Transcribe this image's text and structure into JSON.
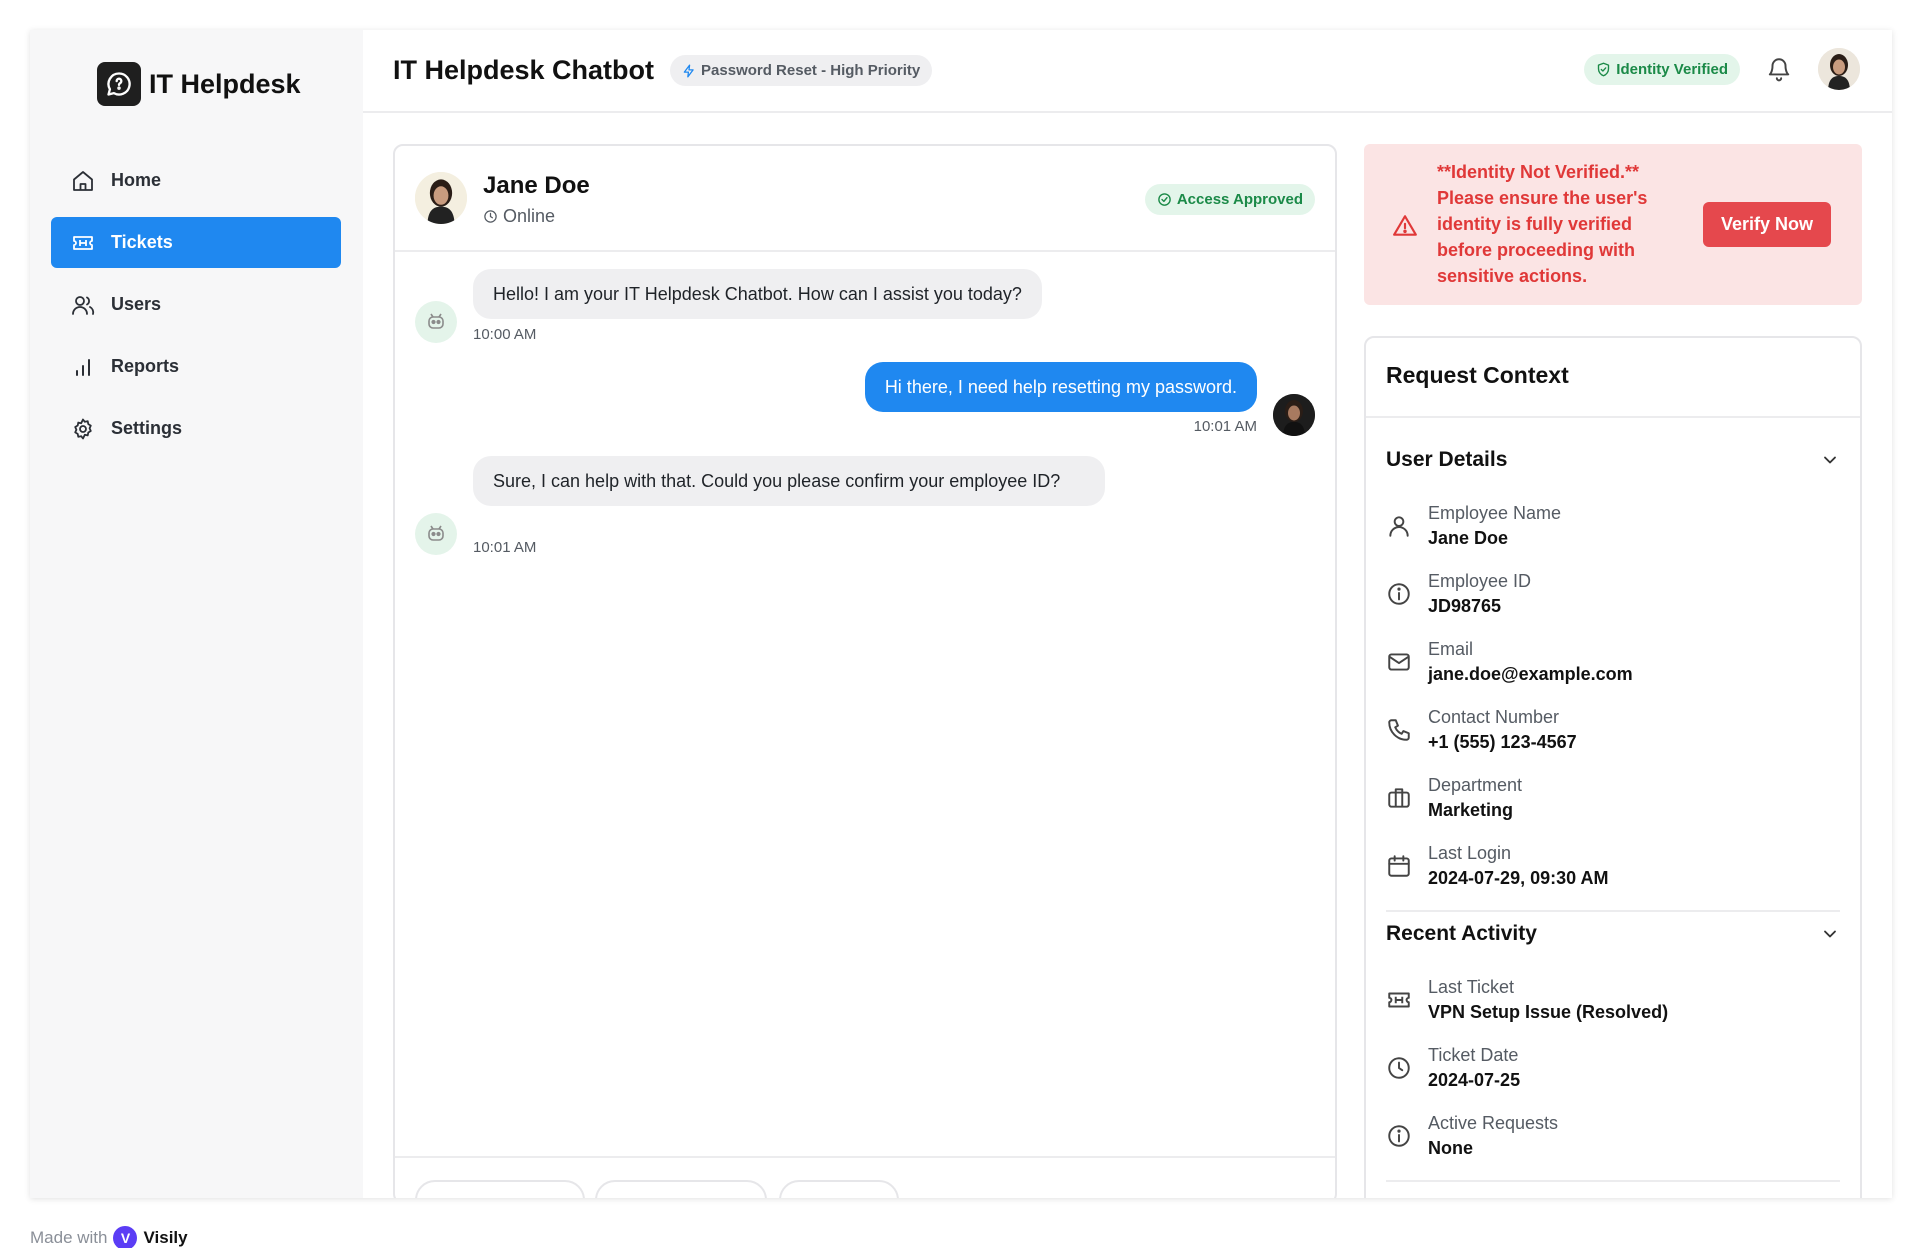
{
  "brand": {
    "name": "IT Helpdesk"
  },
  "sidebar": {
    "items": [
      {
        "label": "Home",
        "icon": "home-icon",
        "active": false
      },
      {
        "label": "Tickets",
        "icon": "ticket-icon",
        "active": true
      },
      {
        "label": "Users",
        "icon": "users-icon",
        "active": false
      },
      {
        "label": "Reports",
        "icon": "bar-chart-icon",
        "active": false
      },
      {
        "label": "Settings",
        "icon": "gear-icon",
        "active": false
      }
    ]
  },
  "header": {
    "title": "IT Helpdesk Chatbot",
    "topic_badge": "Password Reset - High Priority",
    "verified_badge": "Identity Verified"
  },
  "chat": {
    "user_name": "Jane Doe",
    "status": "Online",
    "access_badge": "Access Approved",
    "messages": [
      {
        "from": "bot",
        "text": "Hello! I am your IT Helpdesk Chatbot. How can I assist you today?",
        "time": "10:00 AM"
      },
      {
        "from": "user",
        "text": "Hi there, I need help resetting my password.",
        "time": "10:01 AM"
      },
      {
        "from": "bot",
        "text": "Sure, I can help with that. Could you please confirm your employee ID?",
        "time": "10:01 AM"
      }
    ]
  },
  "alert": {
    "text": "**Identity Not Verified.** Please ensure the user's identity is fully verified before proceeding with sensitive actions.",
    "button": "Verify Now"
  },
  "context": {
    "title": "Request Context",
    "user_details": {
      "heading": "User Details",
      "items": [
        {
          "label": "Employee Name",
          "value": "Jane Doe",
          "icon": "user-icon"
        },
        {
          "label": "Employee ID",
          "value": "JD98765",
          "icon": "info-icon"
        },
        {
          "label": "Email",
          "value": "jane.doe@example.com",
          "icon": "mail-icon"
        },
        {
          "label": "Contact Number",
          "value": "+1 (555) 123-4567",
          "icon": "phone-icon"
        },
        {
          "label": "Department",
          "value": "Marketing",
          "icon": "briefcase-icon"
        },
        {
          "label": "Last Login",
          "value": "2024-07-29, 09:30 AM",
          "icon": "calendar-icon"
        }
      ]
    },
    "recent_activity": {
      "heading": "Recent Activity",
      "items": [
        {
          "label": "Last Ticket",
          "value": "VPN Setup Issue (Resolved)",
          "icon": "ticket-icon"
        },
        {
          "label": "Ticket Date",
          "value": "2024-07-25",
          "icon": "clock-icon"
        },
        {
          "label": "Active Requests",
          "value": "None",
          "icon": "info-icon"
        }
      ]
    }
  },
  "footer": {
    "made_with": "Made with",
    "brand": "Visily"
  },
  "colors": {
    "accent": "#1f88f0",
    "danger": "#e5484d",
    "success": "#1b8a48"
  }
}
